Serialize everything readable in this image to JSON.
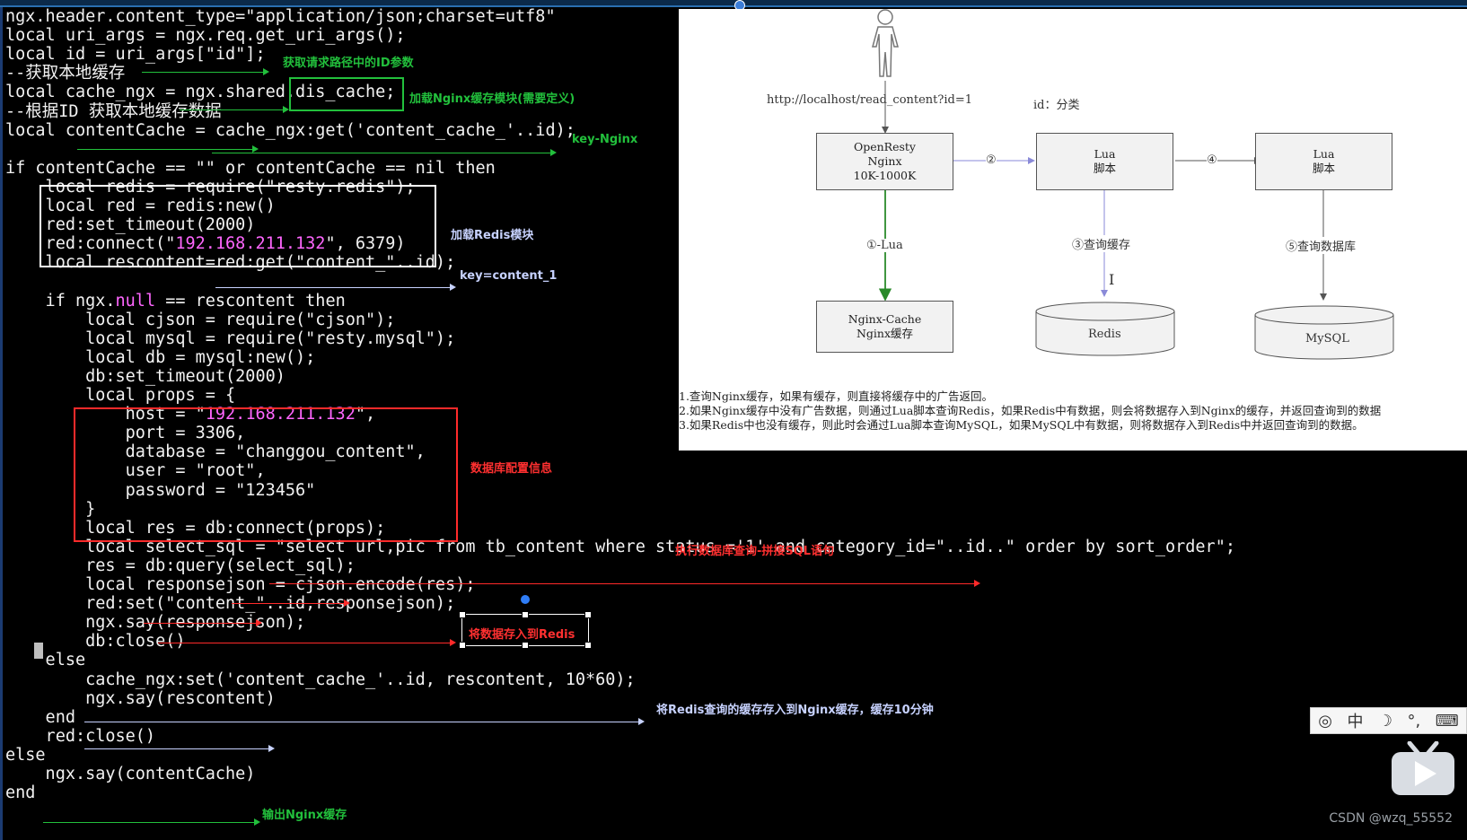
{
  "code_lines": [
    "ngx.header.content_type=\"application/json;charset=utf8\"",
    "local uri_args = ngx.req.get_uri_args();",
    "local id = uri_args[\"id\"];",
    "--获取本地缓存",
    "local cache_ngx = ngx.shared.dis_cache;",
    "--根据ID 获取本地缓存数据",
    "local contentCache = cache_ngx:get('content_cache_'..id);",
    "",
    "if contentCache == \"\" or contentCache == nil then",
    "    local redis = require(\"resty.redis\");",
    "    local red = redis:new()",
    "    red:set_timeout(2000)",
    "    red:connect(\"192.168.211.132\", 6379)",
    "    local rescontent=red:get(\"content_\"..id);",
    "",
    "    if ngx.null == rescontent then",
    "        local cjson = require(\"cjson\");",
    "        local mysql = require(\"resty.mysql\");",
    "        local db = mysql:new();",
    "        db:set_timeout(2000)",
    "        local props = {",
    "            host = \"192.168.211.132\",",
    "            port = 3306,",
    "            database = \"changgou_content\",",
    "            user = \"root\",",
    "            password = \"123456\"",
    "        }",
    "        local res = db:connect(props);",
    "        local select_sql = \"select url,pic from tb_content where status ='1' and category_id=\"..id..\" order by sort_order\";",
    "        res = db:query(select_sql);",
    "        local responsejson = cjson.encode(res);",
    "        red:set(\"content_\"..id,responsejson);",
    "        ngx.say(responsejson);",
    "        db:close()",
    "    else",
    "        cache_ngx:set('content_cache_'..id, rescontent, 10*60);",
    "        ngx.say(rescontent)",
    "    end",
    "    red:close()",
    "else",
    "    ngx.say(contentCache)",
    "end"
  ],
  "annotations": {
    "get_id": "获取请求路径中的ID参数",
    "load_nginx_cache": "加载Nginx缓存模块(需要定义)",
    "key_nginx": "key-Nginx",
    "load_redis": "加载Redis模块",
    "key_content": "key=content_1",
    "db_config": "数据库配置信息",
    "exec_query": "执行数据库查询-拼接SQL语句",
    "save_redis": "将数据存入到Redis",
    "redis_to_nginx": "将Redis查询的缓存存入到Nginx缓存，缓存10分钟",
    "output_nginx": "输出Nginx缓存"
  },
  "diagram": {
    "url": "http://localhost/read_content?id=1",
    "id_label": "id：分类",
    "openresty": [
      "OpenResty",
      "Nginx",
      "10K-1000K"
    ],
    "lua1": [
      "Lua",
      "脚本"
    ],
    "lua2": [
      "Lua",
      "脚本"
    ],
    "nginx_cache": [
      "Nginx-Cache",
      "Nginx缓存"
    ],
    "redis": "Redis",
    "mysql": "MySQL",
    "step1": "①-Lua",
    "step2": "②",
    "step3": "③查询缓存",
    "step4": "④",
    "step5": "⑤查询数据库",
    "notes": [
      "1.查询Nginx缓存，如果有缓存，则直接将缓存中的广告返回。",
      "2.如果Nginx缓存中没有广告数据，则通过Lua脚本查询Redis，如果Redis中有数据，则会将数据存入到Nginx的缓存，并返回查询到的数据",
      "3.如果Redis中也没有缓存，则此时会通过Lua脚本查询MySQL，如果MySQL中有数据，则将数据存入到Redis中并返回查询到的数据。"
    ]
  },
  "ime": {
    "lang": "中",
    "items": [
      "☽",
      "°,",
      "⌨"
    ]
  },
  "watermark": "CSDN @wzq_55552"
}
